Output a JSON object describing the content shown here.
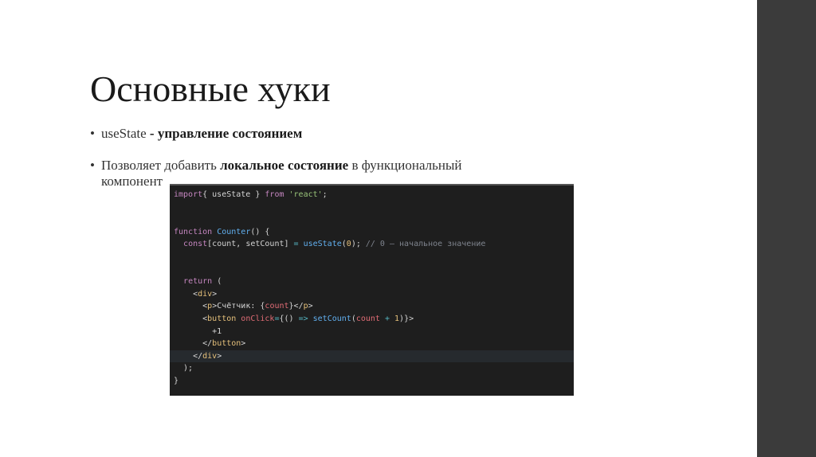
{
  "slide": {
    "title": "Основные хуки",
    "bullets": [
      {
        "pre": "useState",
        "bold": " - управление состоянием",
        "post": ""
      },
      {
        "pre": "Позволяет добавить ",
        "bold": "локальное состояние",
        "post": " в функциональный",
        "cont": "компонент"
      }
    ]
  },
  "code": {
    "lines": [
      [
        [
          "kw",
          "import"
        ],
        [
          "",
          "{ useState } "
        ],
        [
          "kw",
          "from"
        ],
        [
          "",
          ""
        ],
        [
          "str",
          " 'react'"
        ],
        [
          "",
          ";"
        ]
      ],
      [],
      [],
      [
        [
          "kw",
          "function"
        ],
        [
          "fn",
          " Counter"
        ],
        [
          "",
          "() {"
        ]
      ],
      [
        [
          "",
          "  "
        ],
        [
          "kw",
          "const"
        ],
        [
          "",
          ""
        ],
        [
          "",
          "[count, setCount] "
        ],
        [
          "op",
          "="
        ],
        [
          "fn",
          " useState"
        ],
        [
          "",
          "("
        ],
        [
          "num",
          "0"
        ],
        [
          "",
          "); "
        ],
        [
          "cm",
          "// 0 — начальное значение"
        ]
      ],
      [],
      [],
      [
        [
          "",
          "  "
        ],
        [
          "kw",
          "return"
        ],
        [
          "",
          " ("
        ]
      ],
      [
        [
          "",
          "    <"
        ],
        [
          "tag",
          "div"
        ],
        [
          "",
          ">"
        ]
      ],
      [
        [
          "",
          "      <"
        ],
        [
          "tag",
          "p"
        ],
        [
          "",
          ">Счётчик: {"
        ],
        [
          "var",
          "count"
        ],
        [
          "",
          "}</"
        ],
        [
          "tag",
          "p"
        ],
        [
          "",
          ">"
        ]
      ],
      [
        [
          "",
          "      <"
        ],
        [
          "tag",
          "button"
        ],
        [
          "attr",
          " onClick"
        ],
        [
          "op",
          "="
        ],
        [
          "",
          "{() "
        ],
        [
          "op",
          "=>"
        ],
        [
          "fn",
          " setCount"
        ],
        [
          "",
          "("
        ],
        [
          "var",
          "count"
        ],
        [
          "op",
          " +"
        ],
        [
          "num",
          " 1"
        ],
        [
          "",
          ")}>"
        ]
      ],
      [
        [
          "",
          "        +1"
        ]
      ],
      [
        [
          "",
          "      </"
        ],
        [
          "tag",
          "button"
        ],
        [
          "",
          ">"
        ]
      ],
      [
        [
          "",
          "    </"
        ],
        [
          "tag",
          "div"
        ],
        [
          "",
          ">"
        ]
      ],
      [
        [
          "",
          "  );"
        ]
      ],
      [
        [
          "",
          "}"
        ]
      ]
    ],
    "highlighted_line": 13
  }
}
